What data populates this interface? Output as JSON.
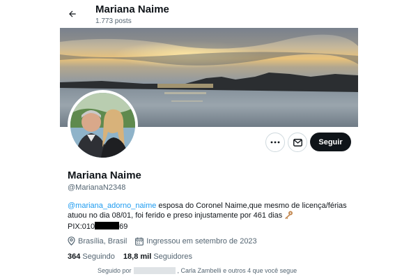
{
  "header": {
    "name": "Mariana Naime",
    "posts": "1.773 posts"
  },
  "actions": {
    "follow_label": "Seguir"
  },
  "profile": {
    "name": "Mariana Naime",
    "handle": "@MarianaN2348",
    "bio": {
      "mention": "@mariana_adorno_naime",
      "line1_rest": " esposa do Coronel Naime,que mesmo de licença/férias",
      "line2": "atuou no dia 08/01, foi ferido e preso injustamente por 461 dias",
      "pix_prefix": "PIX:010",
      "pix_suffix": "69"
    },
    "location": "Brasília, Brasil",
    "joined": "Ingressou em setembro de 2023",
    "following_count": "364",
    "following_label": " Seguindo",
    "followers_count": "18,8 mil",
    "followers_label": " Seguidores",
    "followed_by_prefix": "Seguido por",
    "followed_by_suffix": ", Carla Zambelli e outros 4 que você segue"
  },
  "colors": {
    "accent": "#1d9bf0",
    "text": "#0f1419",
    "muted": "#536471",
    "button_dark": "#0f1419"
  },
  "icons": {
    "back": "arrow-left-icon",
    "more": "more-dots-icon",
    "message": "envelope-icon",
    "location": "location-pin-icon",
    "calendar": "calendar-icon",
    "key": "key-icon"
  }
}
